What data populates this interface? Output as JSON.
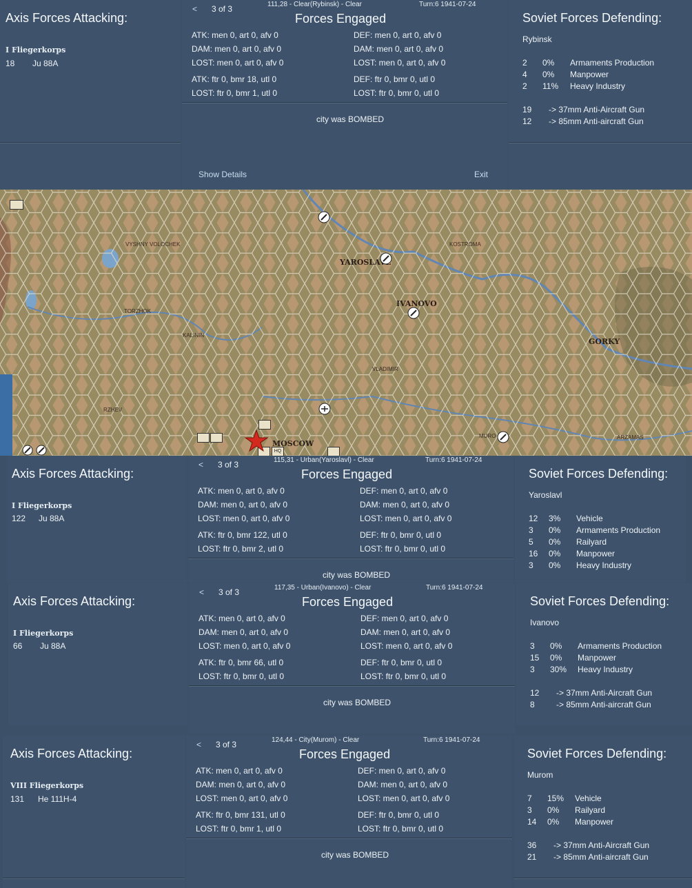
{
  "reports": [
    {
      "axis_title": "Axis Forces Attacking:",
      "axis_unit": "I Fliegerkorps",
      "axis_count": "18",
      "axis_aircraft": "Ju 88A",
      "nav_prev": "<",
      "nav_page": "3 of 3",
      "location": "111,28 - Clear(Rybinsk) - Clear",
      "turn": "Turn:6  1941-07-24",
      "forces_title": "Forces Engaged",
      "atk1": "ATK: men 0, art 0, afv 0",
      "dam1": "DAM: men 0, art 0, afv 0",
      "lost1": "LOST: men 0, art 0, afv 0",
      "atk2": "ATK: ftr 0, bmr 18, utl 0",
      "lost2": "LOST: ftr 0, bmr 1, utl 0",
      "def1": "DEF: men 0, art 0, afv 0",
      "ddam1": "DAM: men 0, art 0, afv 0",
      "dlost1": "LOST: men 0, art 0, afv 0",
      "def2": "DEF: ftr 0, bmr 0, utl 0",
      "dlost2": "LOST: ftr 0, bmr 0, utl 0",
      "result": "city was BOMBED",
      "show_details": "Show Details",
      "exit": "Exit",
      "soviet_title": "Soviet Forces Defending:",
      "city": "Rybinsk",
      "targets": [
        {
          "n": "2",
          "p": "0%",
          "name": "Armaments Production"
        },
        {
          "n": "4",
          "p": "0%",
          "name": "Manpower"
        },
        {
          "n": "2",
          "p": "11%",
          "name": "Heavy Industry"
        }
      ],
      "aa": [
        {
          "n": "19",
          "name": "-> 37mm Anti-Aircraft Gun"
        },
        {
          "n": "12",
          "name": "-> 85mm Anti-aircraft Gun"
        }
      ]
    },
    {
      "axis_title": "Axis Forces Attacking:",
      "axis_unit": "I Fliegerkorps",
      "axis_count": "122",
      "axis_aircraft": "Ju 88A",
      "nav_prev": "<",
      "nav_page": "3 of 3",
      "location": "115,31 - Urban(Yaroslavl) - Clear",
      "turn": "Turn:6  1941-07-24",
      "forces_title": "Forces Engaged",
      "atk1": "ATK: men 0, art 0, afv 0",
      "dam1": "DAM: men 0, art 0, afv 0",
      "lost1": "LOST: men 0, art 0, afv 0",
      "atk2": "ATK: ftr 0, bmr 122, utl 0",
      "lost2": "LOST: ftr 0, bmr 2, utl 0",
      "def1": "DEF: men 0, art 0, afv 0",
      "ddam1": "DAM: men 0, art 0, afv 0",
      "dlost1": "LOST: men 0, art 0, afv 0",
      "def2": "DEF: ftr 0, bmr 0, utl 0",
      "dlost2": "LOST: ftr 0, bmr 0, utl 0",
      "result": "city was BOMBED",
      "soviet_title": "Soviet Forces Defending:",
      "city": "Yaroslavl",
      "targets": [
        {
          "n": "12",
          "p": "3%",
          "name": "Vehicle"
        },
        {
          "n": "3",
          "p": "0%",
          "name": "Armaments Production"
        },
        {
          "n": "5",
          "p": "0%",
          "name": "Railyard"
        },
        {
          "n": "16",
          "p": "0%",
          "name": "Manpower"
        },
        {
          "n": "3",
          "p": "0%",
          "name": "Heavy Industry"
        }
      ]
    },
    {
      "axis_title": "Axis Forces Attacking:",
      "axis_unit": "I Fliegerkorps",
      "axis_count": "66",
      "axis_aircraft": "Ju 88A",
      "nav_prev": "<",
      "nav_page": "3 of 3",
      "location": "117,35 - Urban(Ivanovo) - Clear",
      "turn": "Turn:6  1941-07-24",
      "forces_title": "Forces Engaged",
      "atk1": "ATK: men 0, art 0, afv 0",
      "dam1": "DAM: men 0, art 0, afv 0",
      "lost1": "LOST: men 0, art 0, afv 0",
      "atk2": "ATK: ftr 0, bmr 66, utl 0",
      "lost2": "LOST: ftr 0, bmr 0, utl 0",
      "def1": "DEF: men 0, art 0, afv 0",
      "ddam1": "DAM: men 0, art 0, afv 0",
      "dlost1": "LOST: men 0, art 0, afv 0",
      "def2": "DEF: ftr 0, bmr 0, utl 0",
      "dlost2": "LOST: ftr 0, bmr 0, utl 0",
      "result": "city was BOMBED",
      "soviet_title": "Soviet Forces Defending:",
      "city": "Ivanovo",
      "targets": [
        {
          "n": "3",
          "p": "0%",
          "name": "Armaments Production"
        },
        {
          "n": "15",
          "p": "0%",
          "name": "Manpower"
        },
        {
          "n": "3",
          "p": "30%",
          "name": "Heavy Industry"
        }
      ],
      "aa": [
        {
          "n": "12",
          "name": "-> 37mm Anti-Aircraft Gun"
        },
        {
          "n": "8",
          "name": "-> 85mm Anti-aircraft Gun"
        }
      ]
    },
    {
      "axis_title": "Axis Forces Attacking:",
      "axis_unit": "VIII Fliegerkorps",
      "axis_count": "131",
      "axis_aircraft": "He 111H-4",
      "nav_prev": "<",
      "nav_page": "3 of 3",
      "location": "124,44 - City(Murom) - Clear",
      "turn": "Turn:6  1941-07-24",
      "forces_title": "Forces Engaged",
      "atk1": "ATK: men 0, art 0, afv 0",
      "dam1": "DAM: men 0, art 0, afv 0",
      "lost1": "LOST: men 0, art 0, afv 0",
      "atk2": "ATK: ftr 0, bmr 131, utl 0",
      "lost2": "LOST: ftr 0, bmr 1, utl 0",
      "def1": "DEF: men 0, art 0, afv 0",
      "ddam1": "DAM: men 0, art 0, afv 0",
      "dlost1": "LOST: men 0, art 0, afv 0",
      "def2": "DEF: ftr 0, bmr 0, utl 0",
      "dlost2": "LOST: ftr 0, bmr 0, utl 0",
      "result": "city was BOMBED",
      "soviet_title": "Soviet Forces Defending:",
      "city": "Murom",
      "targets": [
        {
          "n": "7",
          "p": "15%",
          "name": "Vehicle"
        },
        {
          "n": "3",
          "p": "0%",
          "name": "Railyard"
        },
        {
          "n": "14",
          "p": "0%",
          "name": "Manpower"
        }
      ],
      "aa": [
        {
          "n": "36",
          "name": "-> 37mm Anti-Aircraft Gun"
        },
        {
          "n": "21",
          "name": "-> 85mm Anti-aircraft Gun"
        }
      ]
    }
  ],
  "map": {
    "cities": [
      "VYSHNY VOLOCHEK",
      "YAROSLAVL",
      "KOSTROMA",
      "IVANOVO",
      "TORZHOK",
      "KALININ",
      "GORKY",
      "RZHEV",
      "VLADIMIR",
      "MURO",
      "ARZAMAS",
      "MOSCOW"
    ],
    "unit_hq_label": "HQ",
    "colors": {
      "panel": "#3e536b",
      "map_base": "#b89872",
      "forest": "#7d7f55",
      "river": "#5f86b4",
      "star": "#d22a1e"
    }
  }
}
